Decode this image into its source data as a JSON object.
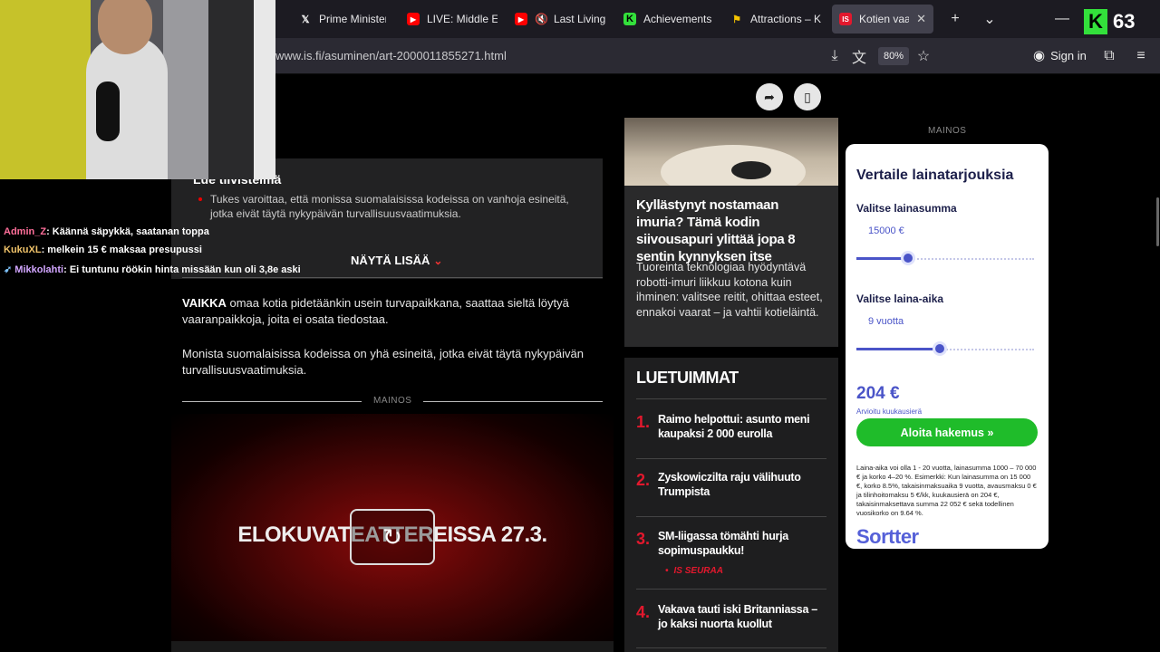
{
  "browser": {
    "tabs": [
      {
        "label": "Prime Minister",
        "icon": "x-logo-icon",
        "icon_color": "#ffffff"
      },
      {
        "label": "LIVE: Middle Ea",
        "icon": "youtube-icon",
        "icon_color": "#ff0000"
      },
      {
        "label": "Last Living",
        "icon": "youtube-icon",
        "icon_color": "#ff0000"
      },
      {
        "label": "Achievements",
        "icon": "kick-icon",
        "icon_color": "#33e03b"
      },
      {
        "label": "Attractions – Ku",
        "icon": "flag-icon",
        "icon_color": "#f5c400"
      },
      {
        "label": "Kotien vaara",
        "icon": "is-logo-icon",
        "icon_color": "#e3182d",
        "active": true
      }
    ],
    "url": "www.is.fi/asuminen/art-2000011855271.html",
    "zoom": "80%",
    "signin_label": "Sign in"
  },
  "overlay": {
    "kick_count": "63",
    "chat": [
      {
        "user": "Admin_Z",
        "user_color": "#ff6f9a",
        "message": "Käännä säpykkä, saatanan toppa"
      },
      {
        "user": "KukuXL",
        "user_color": "#f0c36a",
        "message": "melkein 15 € maksaa presupussi"
      },
      {
        "user": "Mikkolahti",
        "user_color": "#d2a6ff",
        "message": "Ei tuntunu röökin hinta missään kun oli 3,8e aski",
        "badge": "rocket"
      }
    ]
  },
  "article": {
    "box_title": "Lue tiivistelmä",
    "bullet": "Tukes varoittaa, että monissa suomalaisissa kodeissa on vanhoja esineitä, jotka eivät täytä nykypäivän turvallisuusvaatimuksia.",
    "show_more": "NÄYTÄ LISÄÄ",
    "para1_lead": "VAIKKA",
    "para1_rest": " omaa kotia pidetäänkin usein turvapaikkana, saattaa sieltä löytyä vaaranpaikkoja, joita ei osata tiedostaa.",
    "para2": "Monista suomalaisissa kodeissa on yhä esineitä, jotka eivät täytä nykypäivän turvallisuusvaatimuksia.",
    "ad_label": "MAINOS",
    "video_title": "ELOKUVATEATTEREISSA 27.3."
  },
  "promo": {
    "headline": "Kyllästynyt nostamaan imuria? Tämä kodin siivousapuri ylittää jopa 8 sentin kynnyksen itse",
    "text": "Tuoreinta teknologiaa hyödyntävä robotti-imuri liikkuu kotona kuin ihminen: valitsee reitit, ohittaa esteet, ennakoi vaarat – ja vahtii kotieläintä."
  },
  "most_read": {
    "title": "LUETUIMMAT",
    "items": [
      {
        "num": "1.",
        "text": "Raimo helpottui: asunto meni kaupaksi 2 000 eurolla"
      },
      {
        "num": "2.",
        "text": "Zyskowiczilta raju välihuuto Trumpista"
      },
      {
        "num": "3.",
        "text": "SM-liigassa tömähti hurja sopimuspaukku!",
        "tag": "IS SEURAA"
      },
      {
        "num": "4.",
        "text": "Vakava tauti iski Britanniassa – jo kaksi nuorta kuollut"
      }
    ]
  },
  "ad": {
    "label": "MAINOS",
    "title": "Vertaile lainatarjouksia",
    "amount_label": "Valitse lainasumma",
    "amount_value": "15000 €",
    "amount_fraction": 0.29,
    "term_label": "Valitse laina-aika",
    "term_value": "9 vuotta",
    "term_fraction": 0.47,
    "price": "204 €",
    "price_sub": "Arvioitu kuukausierä",
    "cta": "Aloita hakemus  »",
    "fine_print": "Laina-aika voi olla 1 - 20 vuotta, lainasumma 1000 – 70 000 € ja korko 4–20 %. Esimerkki: Kun lainasumma on 15 000 €, korko 8.5%, takaisinmaksuaika 9 vuotta, avausmaksu 0 € ja tilinhoitomaksu 5 €/kk, kuukausierä on 204 €, takaisinmaksettava summa 22 052 € sekä todellinen vuosikorko on 9.64 %.",
    "brand": "Sortter",
    "accent_color": "#4a54c8",
    "cta_color": "#1fbc2a"
  }
}
